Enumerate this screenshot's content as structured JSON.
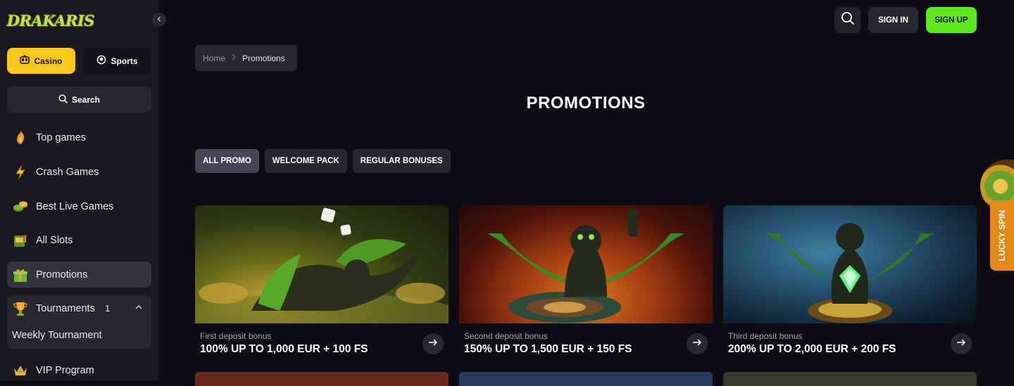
{
  "brand": {
    "logo_text": "DRAKARIS"
  },
  "sidebar": {
    "casino_label": "Casino",
    "sports_label": "Sports",
    "search_label": "Search",
    "items": [
      {
        "label": "Top games",
        "icon": "fire-dice-icon"
      },
      {
        "label": "Crash Games",
        "icon": "lightning-icon"
      },
      {
        "label": "Best Live Games",
        "icon": "chips-icon"
      },
      {
        "label": "All Slots",
        "icon": "slot-machine-icon"
      },
      {
        "label": "Promotions",
        "icon": "gift-icon"
      }
    ],
    "tournaments": {
      "label": "Tournaments",
      "count": "1",
      "sub_item": "Weekly Tournament"
    },
    "vip_label": "VIP Program"
  },
  "header": {
    "sign_in": "SIGN IN",
    "sign_up": "SIGN UP"
  },
  "breadcrumb": {
    "home": "Home",
    "current": "Promotions"
  },
  "page": {
    "title": "PROMOTIONS"
  },
  "filters": [
    "ALL PROMO",
    "WELCOME PACK",
    "REGULAR BONUSES"
  ],
  "promos": [
    {
      "subtitle": "First deposit bonus",
      "title": "100% UP TO 1,000 EUR + 100 FS"
    },
    {
      "subtitle": "Second deposit bonus",
      "title": "150% UP TO 1,500 EUR + 150 FS"
    },
    {
      "subtitle": "Third deposit bonus",
      "title": "200% UP TO 2,000 EUR + 200 FS"
    }
  ],
  "lucky_spin": {
    "label": "LUCKY SPIN"
  },
  "colors": {
    "accent_casino": "#f8c91c",
    "accent_signup": "#5ee61f",
    "background": "#0f0b14",
    "sidebar": "#1c1822"
  }
}
